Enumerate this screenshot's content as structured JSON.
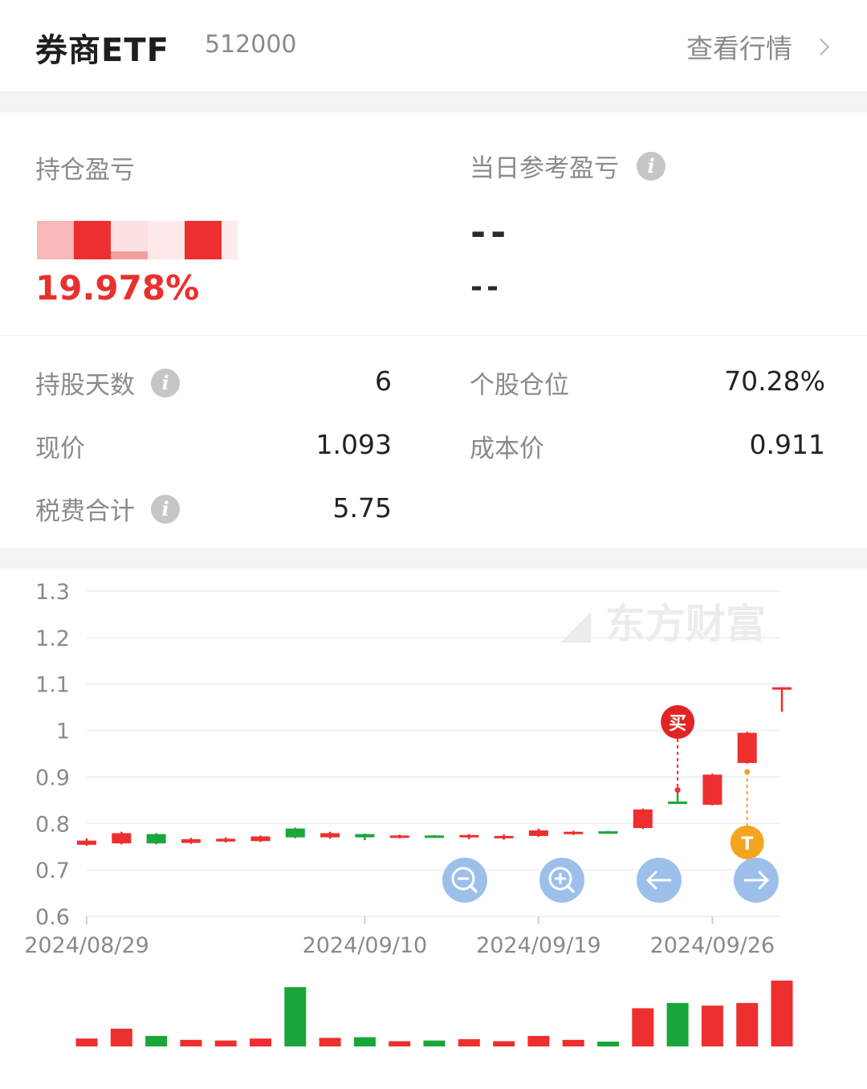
{
  "header": {
    "title": "券商ETF",
    "code": "512000",
    "view_label": "查看行情"
  },
  "pnl": {
    "hold_label": "持仓盈亏",
    "hold_pct": "19.978%",
    "today_label": "当日参考盈亏",
    "today_value": "--",
    "today_sub": "--"
  },
  "stats": {
    "hold_days_label": "持股天数",
    "hold_days": "6",
    "position_label": "个股仓位",
    "position": "70.28%",
    "price_label": "现价",
    "price": "1.093",
    "cost_label": "成本价",
    "cost": "0.911",
    "fee_label": "税费合计",
    "fee": "5.75"
  },
  "colors": {
    "up": "#ee2f2f",
    "down": "#1aa63a",
    "accent": "#e8312f",
    "button": "#9cc0ea"
  },
  "watermark": "东方财富",
  "markers": {
    "buy": "买",
    "t": "T"
  },
  "controls": [
    "zoom-out-icon",
    "zoom-in-icon",
    "arrow-left-icon",
    "arrow-right-icon"
  ],
  "chart_data": {
    "type": "candlestick",
    "yticks": [
      "1.3",
      "1.2",
      "1.1",
      "1",
      "0.9",
      "0.8",
      "0.7",
      "0.6"
    ],
    "ylim": [
      0.6,
      1.3
    ],
    "xticks": [
      {
        "index": 0,
        "label": "2024/08/29"
      },
      {
        "index": 8,
        "label": "2024/09/10"
      },
      {
        "index": 13,
        "label": "2024/09/19"
      },
      {
        "index": 18,
        "label": "2024/09/26"
      }
    ],
    "candles": [
      {
        "o": 0.754,
        "c": 0.763,
        "h": 0.768,
        "l": 0.752
      },
      {
        "o": 0.757,
        "c": 0.779,
        "h": 0.782,
        "l": 0.755
      },
      {
        "o": 0.777,
        "c": 0.757,
        "h": 0.779,
        "l": 0.755
      },
      {
        "o": 0.758,
        "c": 0.766,
        "h": 0.769,
        "l": 0.756
      },
      {
        "o": 0.761,
        "c": 0.767,
        "h": 0.77,
        "l": 0.759
      },
      {
        "o": 0.762,
        "c": 0.772,
        "h": 0.774,
        "l": 0.76
      },
      {
        "o": 0.789,
        "c": 0.77,
        "h": 0.791,
        "l": 0.768
      },
      {
        "o": 0.77,
        "c": 0.779,
        "h": 0.782,
        "l": 0.767
      },
      {
        "o": 0.777,
        "c": 0.77,
        "h": 0.778,
        "l": 0.764
      },
      {
        "o": 0.77,
        "c": 0.774,
        "h": 0.776,
        "l": 0.768
      },
      {
        "o": 0.774,
        "c": 0.771,
        "h": 0.775,
        "l": 0.769
      },
      {
        "o": 0.771,
        "c": 0.775,
        "h": 0.777,
        "l": 0.766
      },
      {
        "o": 0.768,
        "c": 0.773,
        "h": 0.776,
        "l": 0.765
      },
      {
        "o": 0.773,
        "c": 0.785,
        "h": 0.789,
        "l": 0.771
      },
      {
        "o": 0.777,
        "c": 0.782,
        "h": 0.784,
        "l": 0.775
      },
      {
        "o": 0.783,
        "c": 0.781,
        "h": 0.784,
        "l": 0.78
      },
      {
        "o": 0.79,
        "c": 0.83,
        "h": 0.832,
        "l": 0.788
      },
      {
        "o": 0.847,
        "c": 0.845,
        "h": 0.875,
        "l": 0.844
      },
      {
        "o": 0.84,
        "c": 0.905,
        "h": 0.907,
        "l": 0.839
      },
      {
        "o": 0.93,
        "c": 0.995,
        "h": 0.997,
        "l": 0.929
      },
      {
        "o": 1.093,
        "c": 1.093,
        "h": 1.093,
        "l": 1.04
      }
    ],
    "volume_ratio": [
      0.12,
      0.27,
      0.16,
      0.1,
      0.09,
      0.12,
      0.9,
      0.13,
      0.14,
      0.08,
      0.09,
      0.11,
      0.08,
      0.16,
      0.1,
      0.07,
      0.58,
      0.66,
      0.62,
      0.66,
      1.0
    ],
    "buy_index": 17,
    "buy_price": 0.872,
    "t_index": 19,
    "t_price": 0.911
  }
}
